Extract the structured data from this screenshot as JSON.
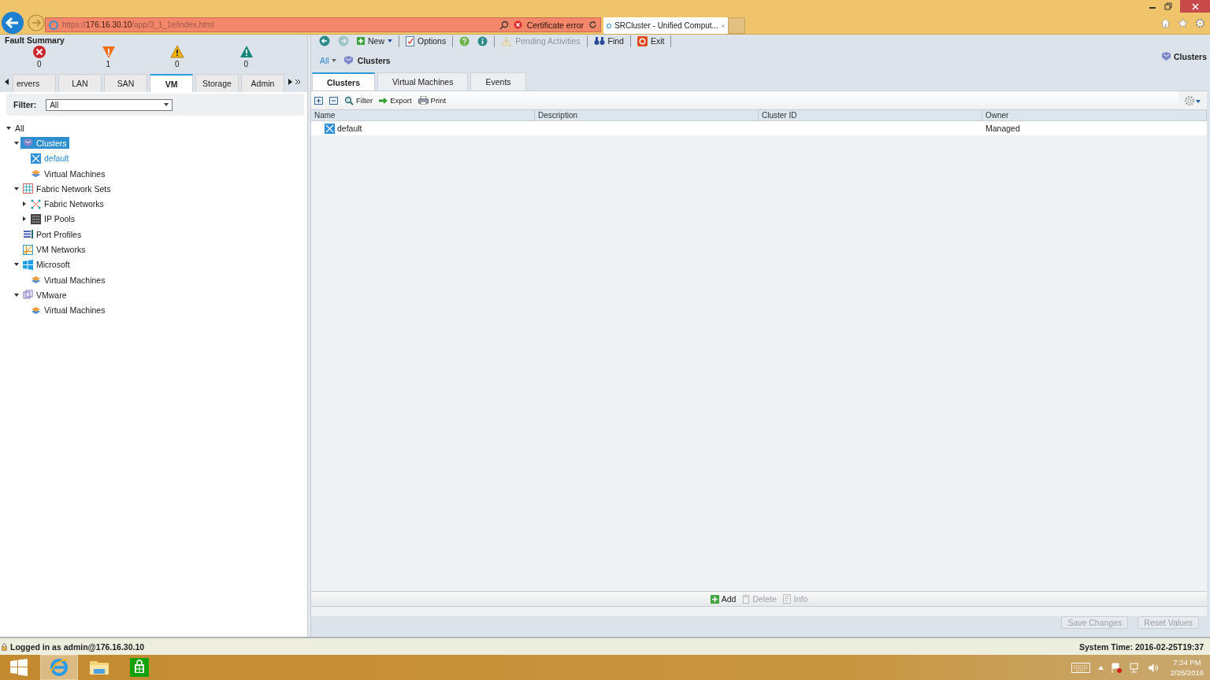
{
  "browser": {
    "url": {
      "scheme": "https://",
      "host": "176.16.30.10",
      "path": "/app/3_1_1e/index.html"
    },
    "cert_error": "Certificate error",
    "tabs": [
      {
        "title": "SRCluster - Unified Comput...",
        "selected": true
      }
    ]
  },
  "fault_summary": {
    "title": "Fault Summary",
    "items": [
      {
        "kind": "critical",
        "count": "0"
      },
      {
        "kind": "major",
        "count": "1"
      },
      {
        "kind": "minor",
        "count": "0"
      },
      {
        "kind": "warning",
        "count": "0"
      }
    ]
  },
  "nav_tabs": [
    {
      "label": "ervers",
      "selected": false
    },
    {
      "label": "LAN",
      "selected": false
    },
    {
      "label": "SAN",
      "selected": false
    },
    {
      "label": "VM",
      "selected": true
    },
    {
      "label": "Storage",
      "selected": false
    },
    {
      "label": "Admin",
      "selected": false
    }
  ],
  "filter": {
    "label": "Filter:",
    "value": "All"
  },
  "tree": [
    {
      "label": "All",
      "expanded": true,
      "selected": false,
      "active": false,
      "children": [
        {
          "label": "Clusters",
          "kind": "cluster",
          "expanded": true,
          "selected": true,
          "active": false,
          "children": [
            {
              "label": "default",
              "kind": "node",
              "selected": false,
              "active": true
            },
            {
              "label": "Virtual Machines",
              "kind": "vms",
              "selected": false,
              "active": false
            }
          ]
        },
        {
          "label": "Fabric Network Sets",
          "kind": "fabricset",
          "expanded": true,
          "selected": false,
          "active": false,
          "children": [
            {
              "label": "Fabric Networks",
              "kind": "fabricnet",
              "expanded": false,
              "selected": false,
              "active": false
            },
            {
              "label": "IP Pools",
              "kind": "pools",
              "expanded": false,
              "selected": false,
              "active": false
            }
          ]
        },
        {
          "label": "Port Profiles",
          "kind": "profiles",
          "selected": false,
          "active": false
        },
        {
          "label": "VM Networks",
          "kind": "vmnetworks",
          "selected": false,
          "active": false
        },
        {
          "label": "Microsoft",
          "kind": "windows",
          "expanded": true,
          "selected": false,
          "active": false,
          "children": [
            {
              "label": "Virtual Machines",
              "kind": "vms",
              "selected": false,
              "active": false
            }
          ]
        },
        {
          "label": "VMware",
          "kind": "vmware",
          "expanded": true,
          "selected": false,
          "active": false,
          "children": [
            {
              "label": "Virtual Machines",
              "kind": "vms",
              "selected": false,
              "active": false
            }
          ]
        }
      ]
    }
  ],
  "toolbar": [
    {
      "kind": "back",
      "disabled": false
    },
    {
      "kind": "forward",
      "disabled": true
    },
    {
      "kind": "new",
      "label": "New",
      "disabled": false
    },
    {
      "kind": "options",
      "label": "Options",
      "disabled": false
    },
    {
      "kind": "help",
      "disabled": false
    },
    {
      "kind": "info",
      "disabled": false
    },
    {
      "kind": "pending",
      "label": "Pending Activities",
      "disabled": true
    },
    {
      "kind": "find",
      "label": "Find",
      "disabled": false
    },
    {
      "kind": "exit",
      "label": "Exit",
      "disabled": false
    }
  ],
  "breadcrumb": {
    "scope": "All",
    "current": "Clusters"
  },
  "page_title": "Clusters",
  "content_tabs": [
    {
      "label": "Clusters",
      "selected": true
    },
    {
      "label": "Virtual Machines",
      "selected": false
    },
    {
      "label": "Events",
      "selected": false
    }
  ],
  "grid_toolbar": [
    {
      "kind": "expand"
    },
    {
      "kind": "collapse"
    },
    {
      "kind": "filter",
      "label": "Filter"
    },
    {
      "kind": "export",
      "label": "Export"
    },
    {
      "kind": "print",
      "label": "Print"
    }
  ],
  "table": {
    "columns": [
      "Name",
      "Description",
      "Cluster ID",
      "Owner"
    ],
    "rows": [
      {
        "cells": [
          "default",
          "",
          "",
          "Managed"
        ]
      }
    ]
  },
  "actions": [
    {
      "kind": "add",
      "label": "Add",
      "disabled": false
    },
    {
      "kind": "delete",
      "label": "Delete",
      "disabled": true
    },
    {
      "kind": "info",
      "label": "Info",
      "disabled": true
    }
  ],
  "buttons": [
    {
      "label": "Save Changes",
      "disabled": true
    },
    {
      "label": "Reset Values",
      "disabled": true
    }
  ],
  "status_bar": {
    "login": "Logged in as admin@176.16.30.10",
    "system_time": "System Time: 2016-02-25T19:37"
  },
  "taskbar": {
    "time": "7:34 PM",
    "date": "2/25/2016"
  }
}
